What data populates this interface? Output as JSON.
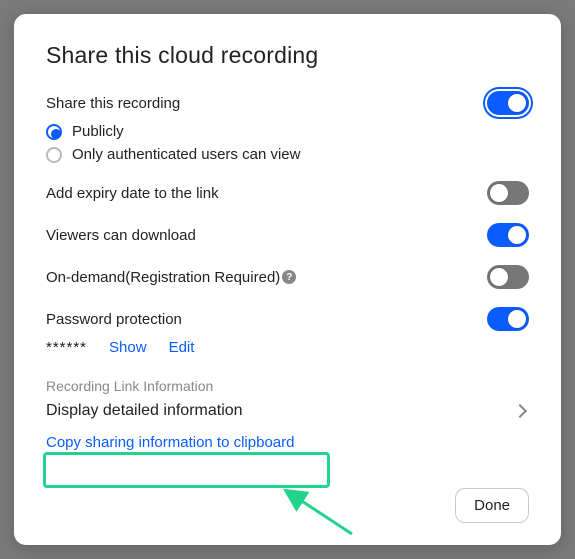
{
  "colors": {
    "accent": "#0b5cff",
    "highlight": "#22d38b"
  },
  "dialog": {
    "title": "Share this cloud recording",
    "shareThisRecording": {
      "label": "Share this recording",
      "enabled": true,
      "options": {
        "publicly": "Publicly",
        "authenticated": "Only authenticated users can view",
        "selected": "publicly"
      }
    },
    "expiry": {
      "label": "Add expiry date to the link",
      "enabled": false
    },
    "download": {
      "label": "Viewers can download",
      "enabled": true
    },
    "onDemand": {
      "label": "On-demand(Registration Required)",
      "enabled": false
    },
    "password": {
      "label": "Password protection",
      "enabled": true,
      "mask": "******",
      "showLabel": "Show",
      "editLabel": "Edit"
    },
    "linkInfo": {
      "sectionLabel": "Recording Link Information",
      "detailLabel": "Display detailed information",
      "copyLabel": "Copy sharing information to clipboard"
    },
    "doneLabel": "Done"
  },
  "icons": {
    "help": "?"
  }
}
